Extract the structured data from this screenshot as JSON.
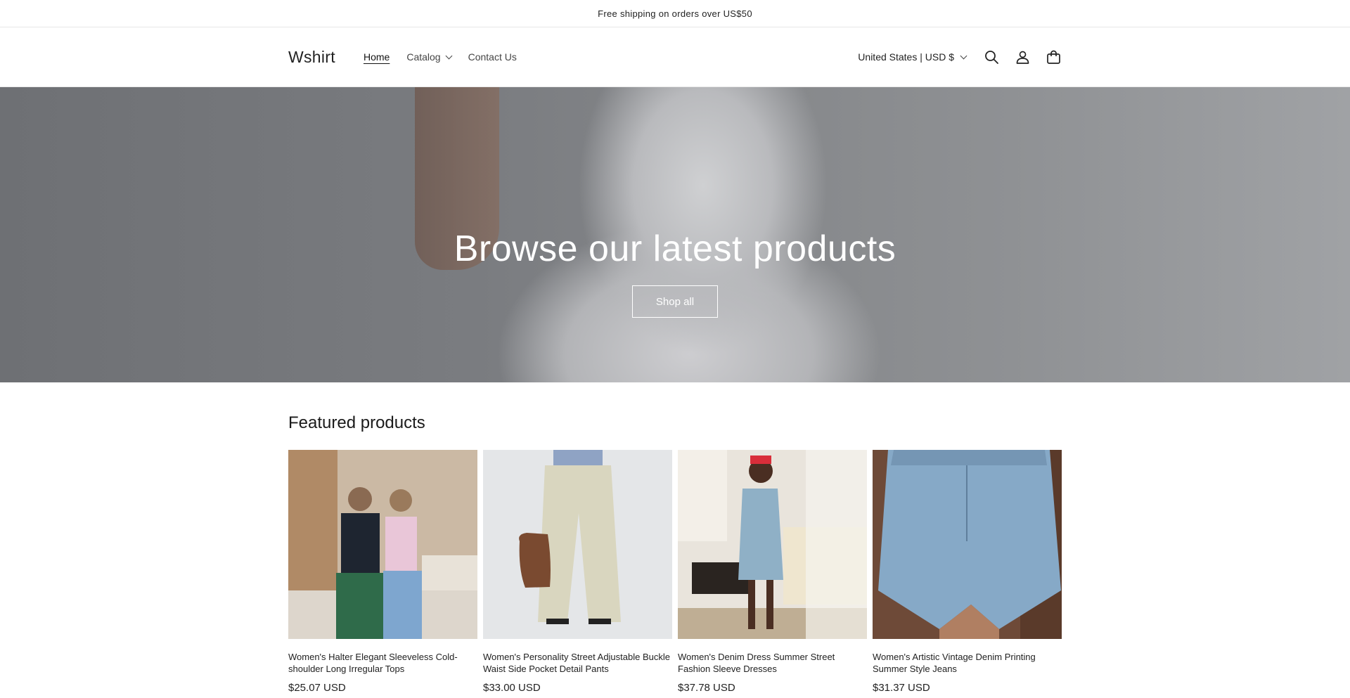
{
  "announcement": "Free shipping on orders over US$50",
  "header": {
    "logo": "Wshirt",
    "nav": [
      {
        "label": "Home"
      },
      {
        "label": "Catalog"
      },
      {
        "label": "Contact Us"
      }
    ],
    "country": "United States | USD $",
    "icons": [
      "search-icon",
      "account-icon",
      "cart-icon"
    ]
  },
  "hero": {
    "title": "Browse our latest products",
    "button": "Shop all"
  },
  "featured": {
    "title": "Featured products",
    "products": [
      {
        "title": "Women's Halter Elegant Sleeveless Cold-shoulder Long Irregular Tops",
        "price": "$25.07 USD"
      },
      {
        "title": "Women's Personality Street Adjustable Buckle Waist Side Pocket Detail Pants",
        "price": "$33.00 USD"
      },
      {
        "title": "Women's Denim Dress Summer Street Fashion Sleeve Dresses",
        "price": "$37.78 USD"
      },
      {
        "title": "Women's Artistic Vintage Denim Printing Summer Style Jeans",
        "price": "$31.37 USD"
      }
    ]
  },
  "colors": {
    "text": "#121212",
    "border": "#e6e6e6",
    "hero_overlay": "#7a7c80"
  }
}
